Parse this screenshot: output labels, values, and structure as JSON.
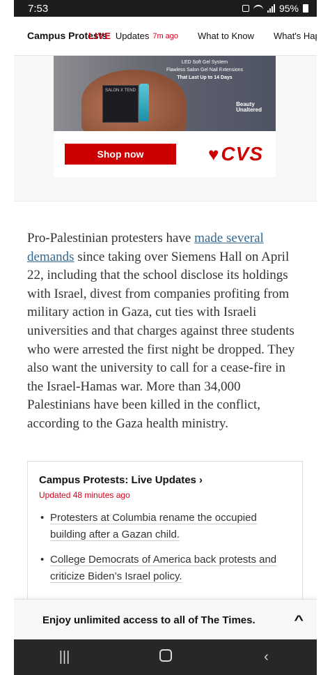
{
  "status_bar": {
    "time": "7:53",
    "battery": "95%"
  },
  "topnav": {
    "brand": "Campus Protests",
    "live_tag": "LIVE",
    "updates_label": "Updates",
    "updated_ago": "7m ago",
    "links": [
      "What to Know",
      "What's Hap"
    ]
  },
  "ad": {
    "line1": "LED Soft Gel System",
    "line2": "Flawless Salon Gel Nail Extensions",
    "line3": "That Last Up to 14 Days",
    "box_label": "SALON X TEND",
    "logo_line1": "Beauty",
    "logo_line2": "Unaltered",
    "shop_button": "Shop now",
    "brand": "CVS"
  },
  "article": {
    "before_link": "Pro-Palestinian protesters have ",
    "link_text": "made several demands",
    "after_link": " since taking over Siemens Hall on April 22, including that the school disclose its holdings with Israel, divest from companies profiting from military action in Gaza, cut ties with Israeli universities and that charges against three students who were arrested the first night be dropped. They also want the university to call for a cease-fire in the Israel-Hamas war. More than 34,000 Palestinians have been killed in the conflict, according to the Gaza health ministry."
  },
  "live_card": {
    "title": "Campus Protests: Live Updates ›",
    "updated": "Updated 48 minutes ago",
    "items": [
      "Protesters at Columbia rename the occupied building after a Gazan child.",
      "College Democrats of America back protests and criticize Biden’s Israel policy."
    ]
  },
  "promo_banner": {
    "text": "Enjoy unlimited access to all of The Times."
  },
  "colors": {
    "live_red": "#d0021b",
    "link_blue": "#326891",
    "cvs_red": "#cc0000"
  }
}
